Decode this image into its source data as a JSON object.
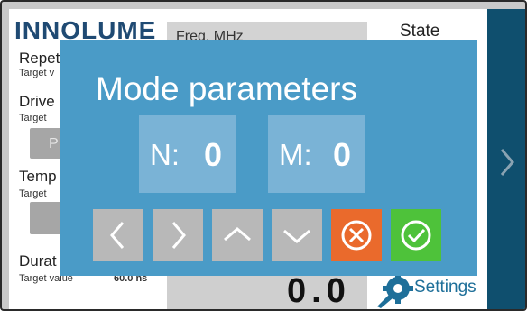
{
  "app": {
    "logo_text": "INNOLUME",
    "labels": {
      "repetition": "Repet",
      "repetition_sub": "Target v",
      "driver": "Drive",
      "driver_sub": "Target",
      "driver_button": "P",
      "temperature": "Temp",
      "temperature_sub": "Target",
      "duration": "Durat",
      "duration_sub": "Target value",
      "duration_value": "60.0 ns"
    },
    "freq_label": "Freq, MHz",
    "state_label": "State",
    "bottom_value": "0.0",
    "settings_label": "Settings",
    "right_nav_icon": "chevron-right-icon"
  },
  "modal": {
    "title": "Mode parameters",
    "params": [
      {
        "label": "N:",
        "value": "0"
      },
      {
        "label": "M:",
        "value": "0"
      }
    ],
    "controls": {
      "left_icon": "chevron-left-icon",
      "right_icon": "chevron-right-icon",
      "up_icon": "chevron-up-icon",
      "down_icon": "chevron-down-icon",
      "cancel_icon": "cancel-icon",
      "ok_icon": "confirm-icon"
    },
    "colors": {
      "modal_bg": "#4a9bc7",
      "param_bg": "#7ab3d6",
      "cancel": "#ea6a2c",
      "ok": "#4ec23a",
      "nav_button": "#b8b8b8"
    }
  }
}
